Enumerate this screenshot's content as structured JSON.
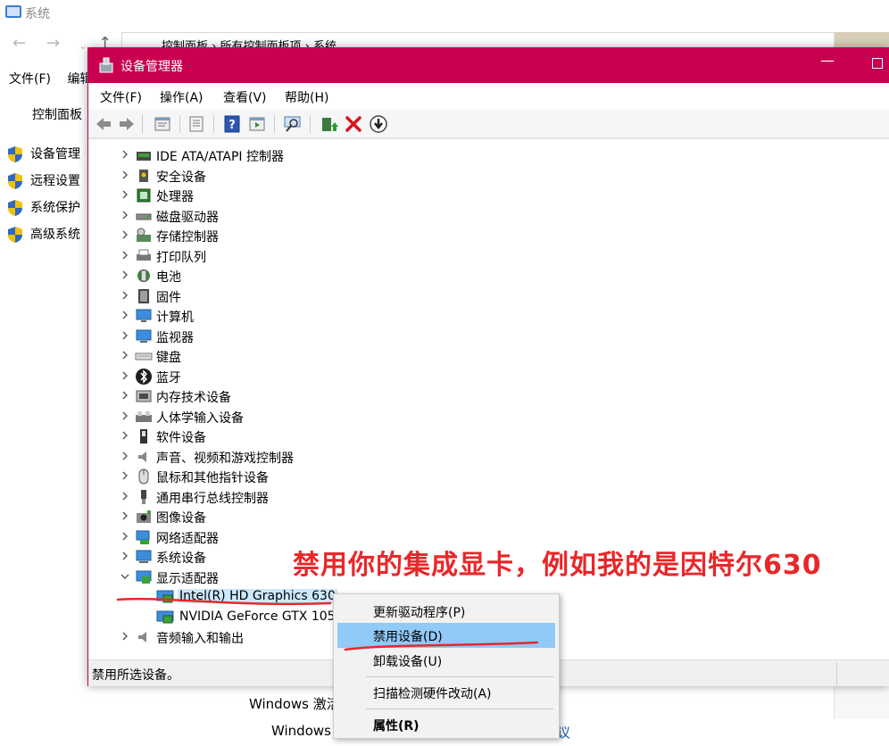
{
  "background": {
    "title": "系统",
    "breadcrumb": [
      "控制面板",
      "所有控制面板项",
      "系统"
    ],
    "menu": [
      "文件(F)",
      "编辑"
    ],
    "control_panel_home": "控制面板",
    "links": [
      "设备管理",
      "远程设置",
      "系统保护",
      "高级系统"
    ],
    "windows_line1": "Windows 激活",
    "windows_line2": "Windows",
    "link_fragment": "议"
  },
  "device_manager": {
    "title": "设备管理器",
    "menu": [
      "文件(F)",
      "操作(A)",
      "查看(V)",
      "帮助(H)"
    ],
    "toolbar_icons": [
      "back-icon",
      "forward-icon",
      "properties-icon",
      "show-hidden-icon",
      "help-icon",
      "device-view-icon",
      "scan-icon",
      "update-driver-icon",
      "uninstall-icon",
      "disable-icon"
    ],
    "categories": [
      {
        "label": "IDE ATA/ATAPI 控制器",
        "icon": "ide-controller-icon"
      },
      {
        "label": "安全设备",
        "icon": "security-device-icon"
      },
      {
        "label": "处理器",
        "icon": "processor-icon"
      },
      {
        "label": "磁盘驱动器",
        "icon": "disk-drive-icon"
      },
      {
        "label": "存储控制器",
        "icon": "storage-controller-icon"
      },
      {
        "label": "打印队列",
        "icon": "print-queue-icon"
      },
      {
        "label": "电池",
        "icon": "battery-icon"
      },
      {
        "label": "固件",
        "icon": "firmware-icon"
      },
      {
        "label": "计算机",
        "icon": "computer-icon"
      },
      {
        "label": "监视器",
        "icon": "monitor-icon"
      },
      {
        "label": "键盘",
        "icon": "keyboard-icon"
      },
      {
        "label": "蓝牙",
        "icon": "bluetooth-icon"
      },
      {
        "label": "内存技术设备",
        "icon": "memory-device-icon"
      },
      {
        "label": "人体学输入设备",
        "icon": "hid-icon"
      },
      {
        "label": "软件设备",
        "icon": "software-device-icon"
      },
      {
        "label": "声音、视频和游戏控制器",
        "icon": "sound-icon"
      },
      {
        "label": "鼠标和其他指针设备",
        "icon": "mouse-icon"
      },
      {
        "label": "通用串行总线控制器",
        "icon": "usb-icon"
      },
      {
        "label": "图像设备",
        "icon": "imaging-device-icon"
      },
      {
        "label": "网络适配器",
        "icon": "network-adapter-icon"
      },
      {
        "label": "系统设备",
        "icon": "system-device-icon"
      },
      {
        "label": "显示适配器",
        "icon": "display-adapter-icon",
        "expanded": true
      },
      {
        "label": "音频输入和输出",
        "icon": "audio-io-icon"
      }
    ],
    "display_children": [
      "Intel(R) HD Graphics 630",
      "NVIDIA GeForce GTX 105"
    ],
    "status": "禁用所选设备。"
  },
  "context_menu": {
    "items": [
      "更新驱动程序(P)",
      "禁用设备(D)",
      "卸载设备(U)",
      "扫描检测硬件改动(A)",
      "属性(R)"
    ],
    "highlighted": "禁用设备(D)"
  },
  "annotation": "禁用你的集成显卡，例如我的是因特尔630",
  "colors": {
    "title_bar": "#c8004f",
    "annotation": "#e8272a",
    "highlight": "#91c9f7",
    "selected": "#cce8ff"
  }
}
